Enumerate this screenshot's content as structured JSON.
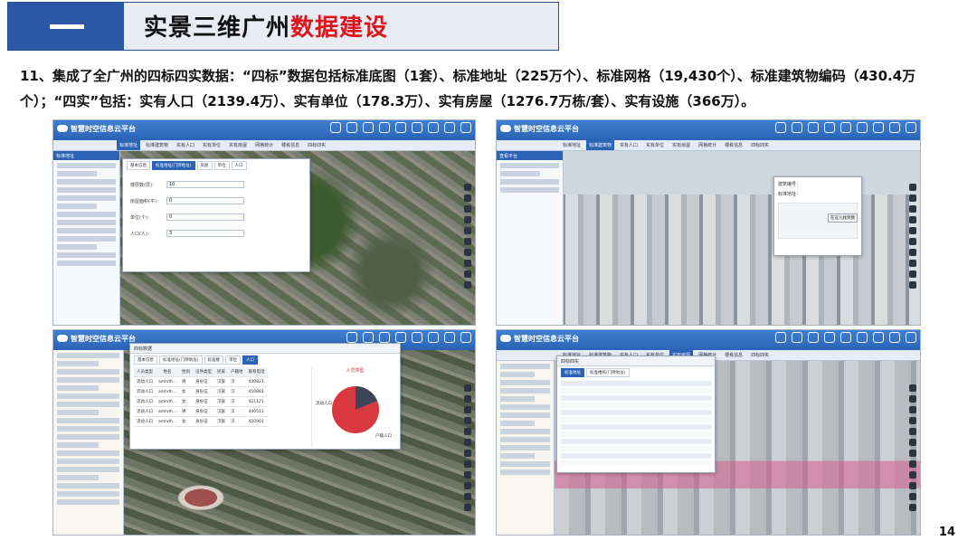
{
  "header": {
    "title_black": "实景三维广州",
    "title_red": "数据建设"
  },
  "description": "11、集成了全广州的四标四实数据：“四标”数据包括标准底图（1套）、标准地址（225万个）、标准网格（19,430个）、标准建筑物编码（430.4万个）；“四实”包括：实有人口（2139.4万）、实有单位（178.3万）、实有房屋（1276.7万栋/套）、实有设施（366万）。",
  "page_number": "14",
  "app": {
    "name": "智慧时空信息云平台",
    "tabs": [
      "标准地址",
      "标准建筑物",
      "实有人口",
      "实有单位",
      "实有房屋",
      "网格统计",
      "楼栋信息",
      "四标四实"
    ]
  },
  "shot1": {
    "panel_title": "标准地址",
    "dialog_tabs": [
      "基本信息",
      "标准地址(门牌地址)",
      "房屋",
      "单位",
      "人口"
    ],
    "fields": [
      {
        "label": "楼层数(层)：",
        "value": "10"
      },
      {
        "label": "房屋面积(平)：",
        "value": "0"
      },
      {
        "label": "单位(个)：",
        "value": "0"
      },
      {
        "label": "人口(人)：",
        "value": "3"
      }
    ]
  },
  "shot2": {
    "panel_title": "查看平台",
    "popup": {
      "line1": "建筑编号：",
      "line2": "标准地址：",
      "button": "在这儿找到我"
    }
  },
  "shot3": {
    "dialog_title": "四标数据",
    "dialog_tabs": [
      "基本信息",
      "标准地址(门牌地址)",
      "标准楼",
      "单位",
      "人口"
    ],
    "headers": [
      "人员类型",
      "姓名",
      "性别",
      "证件类型",
      "民族",
      "户籍地",
      "联系电话"
    ],
    "rows": [
      [
        "流动人口",
        "amhdh...",
        "男",
        "身份证",
        "汉族",
        "汉",
        "440821"
      ],
      [
        "流动人口",
        "amhdh...",
        "女",
        "身份证",
        "汉族",
        "汉",
        "450881"
      ],
      [
        "流动人口",
        "amhdh...",
        "女",
        "身份证",
        "汉族",
        "汉",
        "421121"
      ],
      [
        "流动人口",
        "amhdh...",
        "男",
        "身份证",
        "汉族",
        "汉",
        "440511"
      ],
      [
        "流动人口",
        "amhdh...",
        "女",
        "身份证",
        "汉族",
        "汉",
        "420901"
      ]
    ],
    "pie_title": "人员类型",
    "pie_labels": [
      "流动人口",
      "户籍人口"
    ],
    "pie_colors": [
      "#d9383e",
      "#3a4656"
    ]
  },
  "shot4": {
    "dialog_title": "四标四实",
    "dialog_tabs": [
      "标准地址",
      "标准楼栋(门牌地址)"
    ],
    "row_count": 12
  }
}
